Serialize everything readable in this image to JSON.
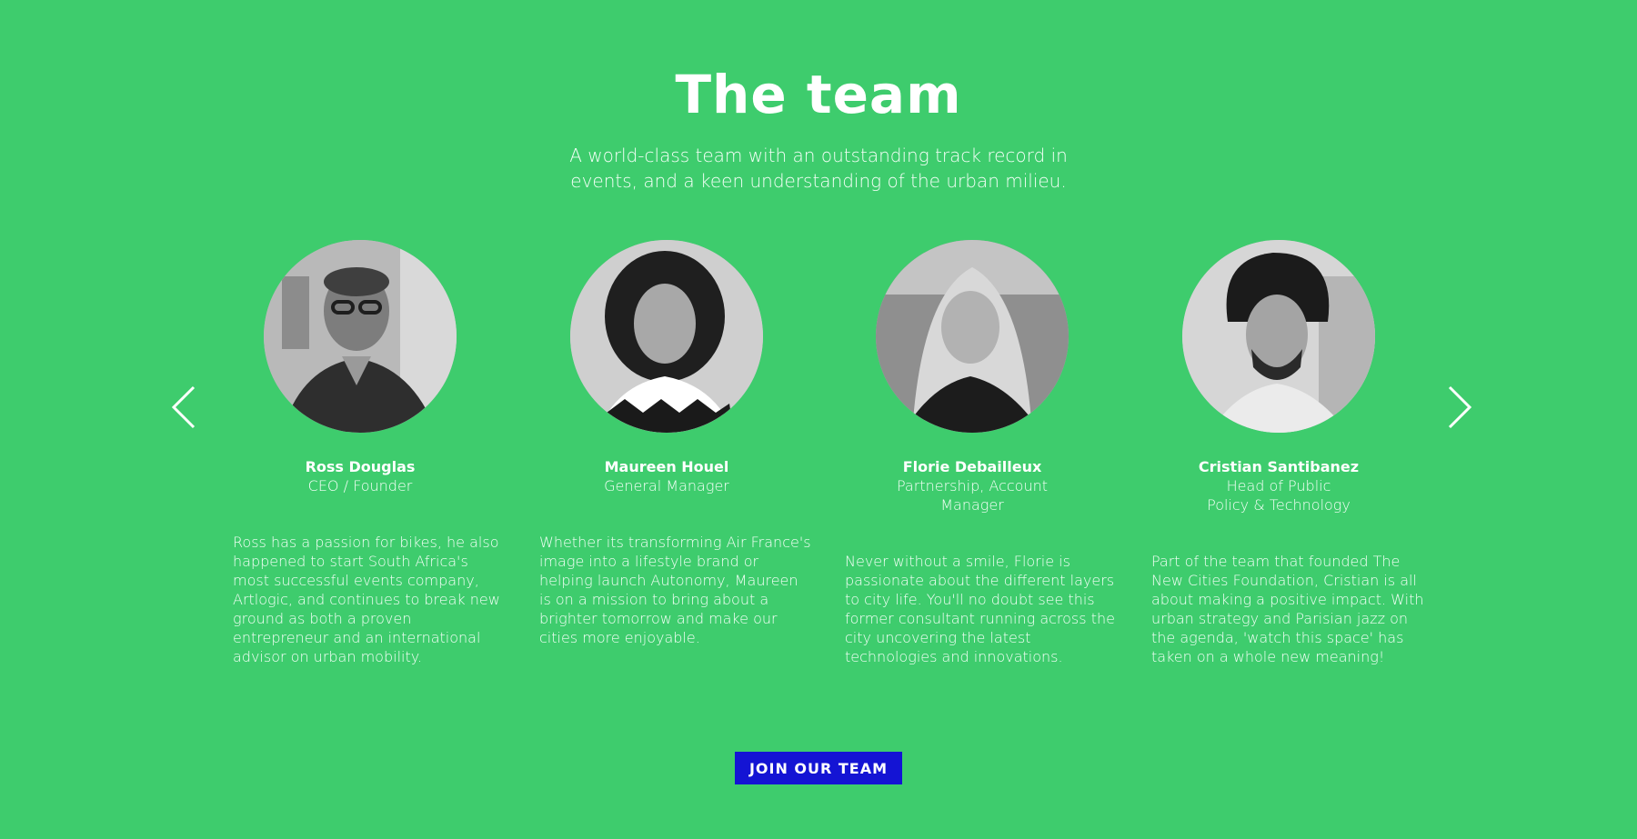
{
  "team": {
    "title": "The team",
    "subtitle": "A world-class team with an outstanding track record in events, and a keen understanding of the urban milieu."
  },
  "carousel": {
    "prev_icon": "chevron-left-icon",
    "next_icon": "chevron-right-icon"
  },
  "members": [
    {
      "name": "Ross Douglas",
      "role": "CEO / Founder",
      "bio": "Ross has a passion for bikes, he also happened to start South Africa's most successful events company, Artlogic, and continues to break new ground as both a proven entrepreneur and an international advisor on urban mobility."
    },
    {
      "name": "Maureen Houel",
      "role": "General Manager",
      "bio": "Whether its transforming Air France's image into a lifestyle brand or helping launch Autonomy, Maureen is on a mission to bring about a brighter tomorrow and make our cities more enjoyable."
    },
    {
      "name": "Florie Debailleux",
      "role": "Partnership, Account Manager",
      "bio": "Never without a smile, Florie is passionate about the different layers to city life. You'll no doubt see this former consultant running across the city uncovering the latest technologies and innovations."
    },
    {
      "name": "Cristian Santibanez",
      "role": "Head of Public Policy & Technology",
      "bio": "Part of the team that founded The New Cities Foundation, Cristian is all about making a positive impact. With urban strategy and Parisian jazz on the agenda, 'watch this space' has taken on a whole new meaning!"
    }
  ],
  "cta": {
    "label": "JOIN OUR TEAM"
  },
  "colors": {
    "background": "#3ecc6d",
    "button": "#1414d4",
    "text": "#ffffff"
  }
}
